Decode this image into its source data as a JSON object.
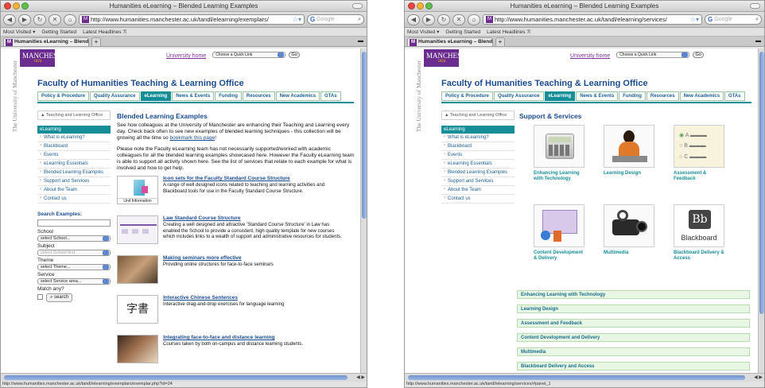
{
  "left": {
    "window_title": "Humanities eLearning – Blended Learning Examples",
    "url": "http://www.humanities.manchester.ac.uk/tandl/elearning/exemplars/",
    "search_placeholder": "Google",
    "bookmarks": [
      "Most Visited ▾",
      "Getting Started",
      "Latest Headlines ℛ"
    ],
    "tab_label": "Humanities eLearning – Blended L...",
    "status_url": "http://www.humanities.manchester.ac.uk/tandl/elearning/exemplars/exemplar.php?id=24",
    "page_title": "Blended Learning Examples",
    "intro1": "See how colleagues at the University of Manchester are enhancing their Teaching and Learning every day. Check back often to see new examples of blended learning techniques - this collection will be growing all the time so",
    "intro_link": "bookmark this page",
    "intro1_end": "!",
    "intro2": "Please note the Faculty eLearning team has not necessarily supported/worked with academic colleagues for all the blended learning examples showcased here. However the Faculty eLearning team is able to support all activity shown here. See the list of services that relate to each example for what is involved and how to get help.",
    "nav": [
      "What is eLearning?",
      "Blackboard",
      "Events",
      "eLearning Essentials",
      "Blended Learning Examples",
      "Support and Services",
      "About the Team",
      "Contact us"
    ],
    "examples": [
      {
        "title": "Icon sets for the Faculty Standard Course Structure",
        "desc": "A range of well designed icons related to teaching and learning activities and Blackboard tools for use in the Faculty Standard Course Structure.",
        "thumb_caption": "Unit Information"
      },
      {
        "title": "Law Standard Course Structure",
        "desc": "Creating a well designed and attractive 'Standard Course Structure' in Law has enabled the School to provide a consistent, high quality template for new courses which includes links to a wealth of support and administrative resources for students."
      },
      {
        "title": "Making seminars more effective",
        "desc": "Providing online structures for face-to-face seminars"
      },
      {
        "title": "Interactive Chinese Sentences",
        "desc": "Interactive drag-and-drop exercises for language learning"
      },
      {
        "title": "Integrating face-to-face and distance learning",
        "desc": "Courses taken by both on-campus and distance learning students."
      }
    ],
    "search": {
      "title": "Search Examples:",
      "school_label": "School",
      "school_value": "select School...",
      "subject_label": "Subject",
      "subject_value": "select School first",
      "theme_label": "Theme",
      "theme_value": "select Theme...",
      "service_label": "Service",
      "service_value": "select Service area...",
      "match_label": "Match any?",
      "search_button": "search"
    }
  },
  "right": {
    "window_title": "Humanities eLearning – Blended Learning Examples",
    "url": "http://www.humanities.manchester.ac.uk/tandl/elearning/services/",
    "search_placeholder": "Google",
    "bookmarks": [
      "Most Visited ▾",
      "Getting Started",
      "Latest Headlines ℛ"
    ],
    "tab_label": "Humanities eLearning – Blended L...",
    "status_url": "http://www.humanities.manchester.ac.uk/tandl/elearning/services/#panel_1",
    "page_title": "Support & Services",
    "nav": [
      "What is eLearning?",
      "Blackboard",
      "Events",
      "eLearning Essentials",
      "Blended Learning Examples",
      "Support and Services",
      "About the Team",
      "Contact us"
    ],
    "services": [
      "Enhancing Learning with Technology",
      "Learning Design",
      "Assessment & Feedback",
      "Content Development & Delivery",
      "Multimedia",
      "Blackboard Delivery & Access"
    ],
    "blackboard_logo_text": "Blackboard",
    "blackboard_logo_letters": "Bb",
    "quiz_letters": [
      "A",
      "B",
      "C"
    ],
    "accordion": [
      "Enhancing Learning with Technology",
      "Learning Design",
      "Assessment and Feedback",
      "Content Development and Delivery",
      "Multimedia",
      "Blackboard Delivery and Access"
    ]
  },
  "shared": {
    "logo_name": "MANCHESTER",
    "logo_year": "1824",
    "university_home": "University home",
    "quick_link": "Choose a Quick Link",
    "go": "Go",
    "vertical_logo": "The University of Manchester",
    "faculty_title": "Faculty of Humanities Teaching & Learning Office",
    "main_nav": [
      "Policy & Procedure",
      "Quality Assurance",
      "eLearning",
      "News & Events",
      "Funding",
      "Resources",
      "New Academics",
      "GTAs"
    ],
    "crumb": "Teaching and Learning Office",
    "nav_header": "eLearning",
    "colors": {
      "teal": "#168e98",
      "purple": "#6a2c8e",
      "navy": "#1b4c91"
    }
  }
}
